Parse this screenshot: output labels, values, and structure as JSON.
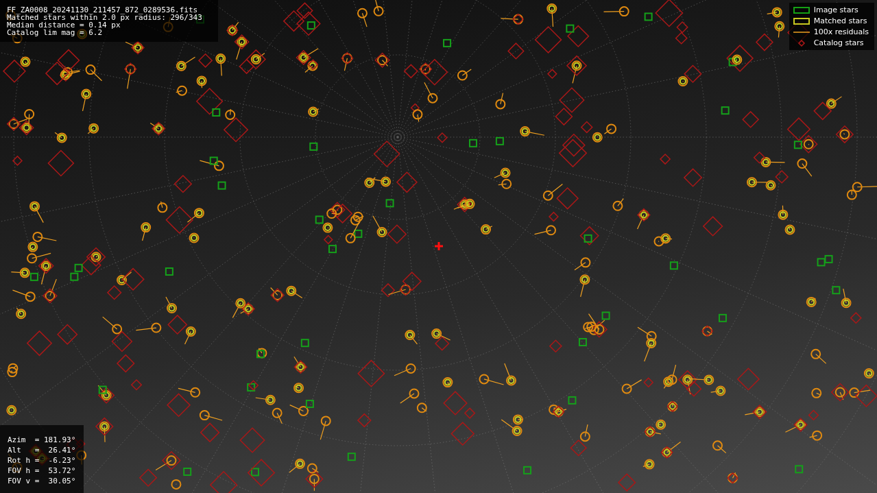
{
  "file_info": {
    "lines": [
      "FF_ZA0008_20241130_211457_872_0289536.fits",
      "Matched stars within 2.0 px radius: 296/343",
      "Median distance = 0.14 px",
      "Catalog lim mag = 6.2"
    ]
  },
  "legend": [
    {
      "kind": "image",
      "label": "Image stars"
    },
    {
      "kind": "matched",
      "label": "Matched stars"
    },
    {
      "kind": "residual",
      "label": "100x residuals"
    },
    {
      "kind": "catalog",
      "label": "Catalog stars"
    }
  ],
  "pointing": {
    "lines": [
      "Azim  = 181.93°",
      "Alt   =  26.41°",
      "Rot h =  -6.23°",
      "FOV h =  53.72°",
      "FOV v =  30.05°"
    ]
  }
}
